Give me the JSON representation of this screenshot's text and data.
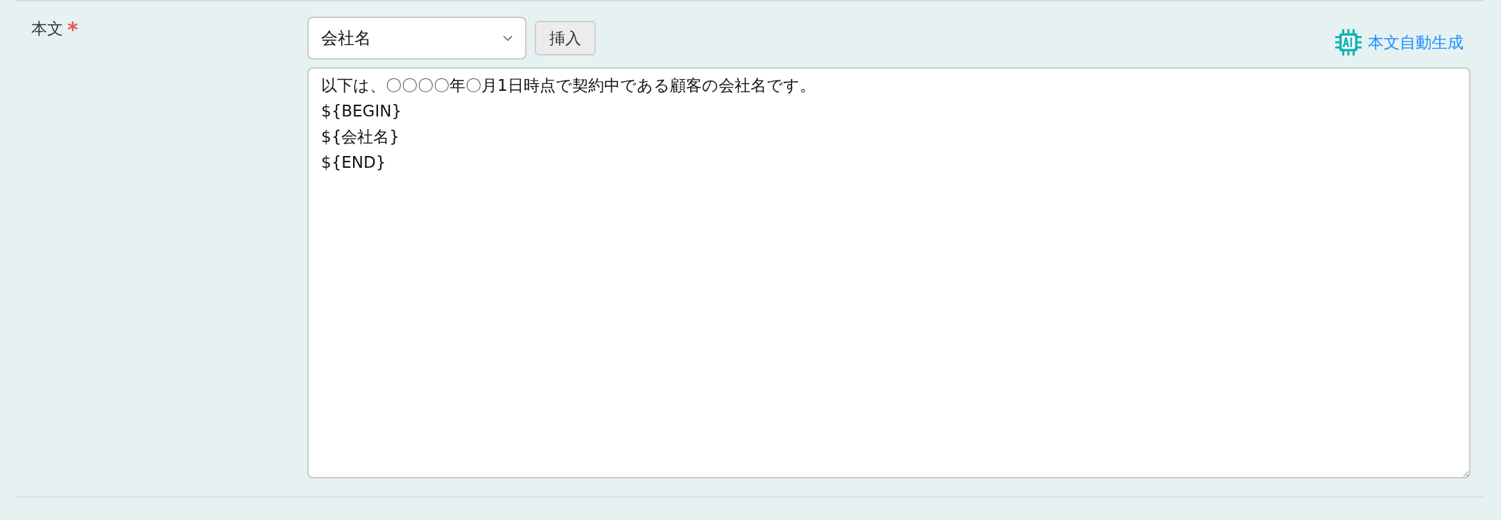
{
  "field": {
    "label": "本文",
    "required_mark": "*"
  },
  "insert_select": {
    "value": "会社名"
  },
  "insert_button": {
    "label": "挿入"
  },
  "ai_link": {
    "label": "本文自動生成"
  },
  "body": {
    "lines": [
      "以下は、〇〇〇〇年〇月1日時点で契約中である顧客の会社名です。",
      "${BEGIN}",
      "${会社名}",
      "${END}"
    ]
  }
}
